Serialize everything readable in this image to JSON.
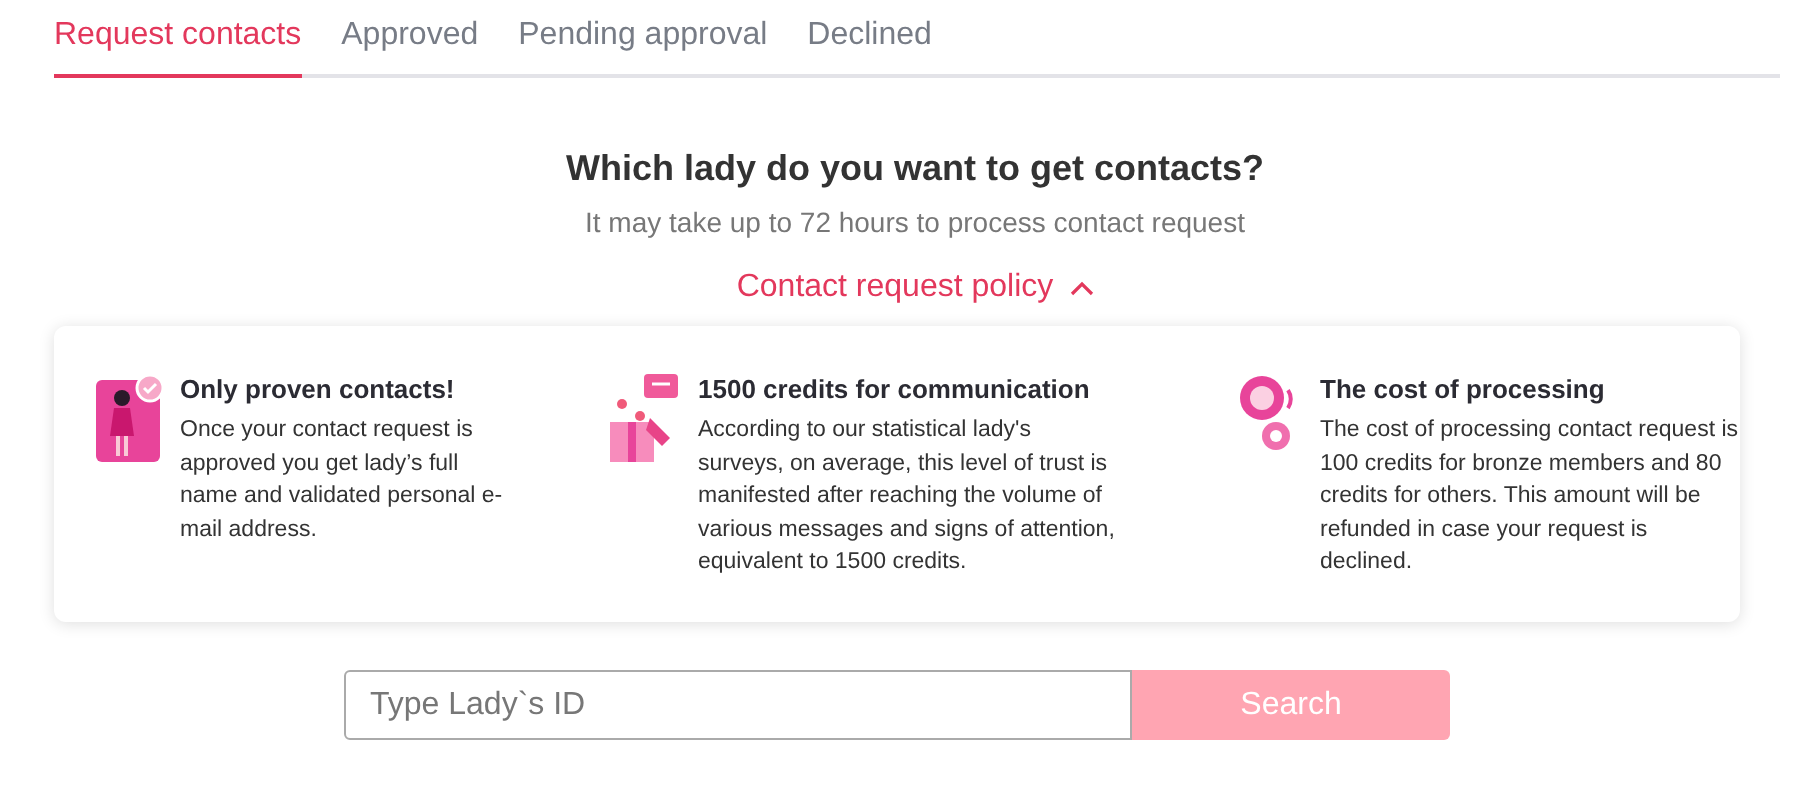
{
  "tabs": [
    {
      "label": "Request contacts",
      "selected": true
    },
    {
      "label": "Approved",
      "selected": false
    },
    {
      "label": "Pending approval",
      "selected": false
    },
    {
      "label": "Declined",
      "selected": false
    }
  ],
  "heading": "Which lady do you want to get contacts?",
  "subtitle": "It may take up to 72 hours to process contact request",
  "policy": {
    "label": "Contact request policy",
    "expanded": true
  },
  "features": [
    {
      "kind": "proven",
      "title": "Only proven contacts!",
      "text": "Once your contact request is approved you get lady’s full name and validated personal e-mail address."
    },
    {
      "kind": "credits",
      "title": "1500 credits for communication",
      "text": "According to our statistical lady's surveys, on average, this level of trust is manifested after reaching the volume of various messages and signs of attention, equivalent to 1500 credits."
    },
    {
      "kind": "cost",
      "title": "The cost of processing",
      "text": "The cost of processing contact request is 100 credits for bronze members and 80 credits for others. This amount will be refunded in case your request is declined."
    }
  ],
  "search": {
    "placeholder": "Type Lady`s ID",
    "button": "Search",
    "disabled": true
  }
}
